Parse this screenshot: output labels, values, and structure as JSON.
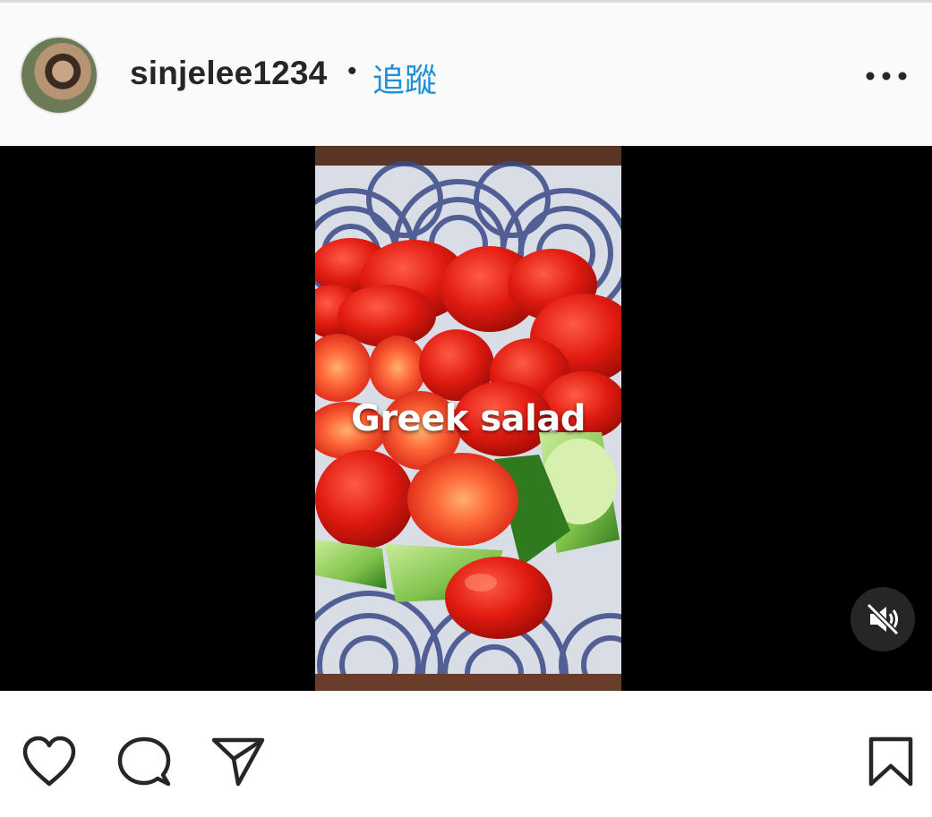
{
  "post": {
    "username": "sinjelee1234",
    "separator": "•",
    "follow_label": "追蹤"
  },
  "video": {
    "caption": "Greek salad",
    "muted": true
  },
  "icons": {
    "more": "more-options-icon",
    "like": "heart-icon",
    "comment": "comment-icon",
    "share": "send-icon",
    "save": "bookmark-icon",
    "mute": "muted-speaker-icon"
  },
  "colors": {
    "follow": "#1f8fd6",
    "text": "#262626"
  }
}
